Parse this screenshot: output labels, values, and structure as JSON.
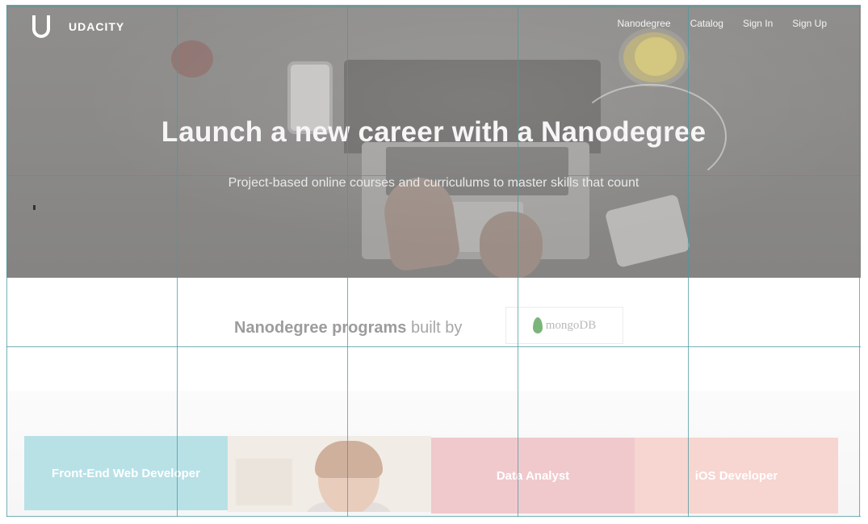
{
  "brand": {
    "name": "UDACITY",
    "logo_icon": "udacity-u-logo-icon"
  },
  "nav": {
    "items": [
      "Nanodegree",
      "Catalog",
      "Sign In",
      "Sign Up"
    ]
  },
  "hero": {
    "title": "Launch a new career with a Nanodegree",
    "subtitle": "Project-based online courses and curriculums to master skills that count"
  },
  "built_by": {
    "strong": "Nanodegree programs",
    "rest": "built by",
    "partner": "mongoDB",
    "partner_icon": "leaf-icon"
  },
  "cards": [
    {
      "label": "Front-End Web Developer",
      "color": "#b8e1e6"
    },
    {
      "label": "",
      "color": "#f2ece6"
    },
    {
      "label": "Data Analyst",
      "color": "#f0c9cd"
    },
    {
      "label": "iOS Developer",
      "color": "#f7d5d0"
    }
  ],
  "colors": {
    "grid_overlay": "#4898a0",
    "hero_overlay": "#8b8a88"
  }
}
